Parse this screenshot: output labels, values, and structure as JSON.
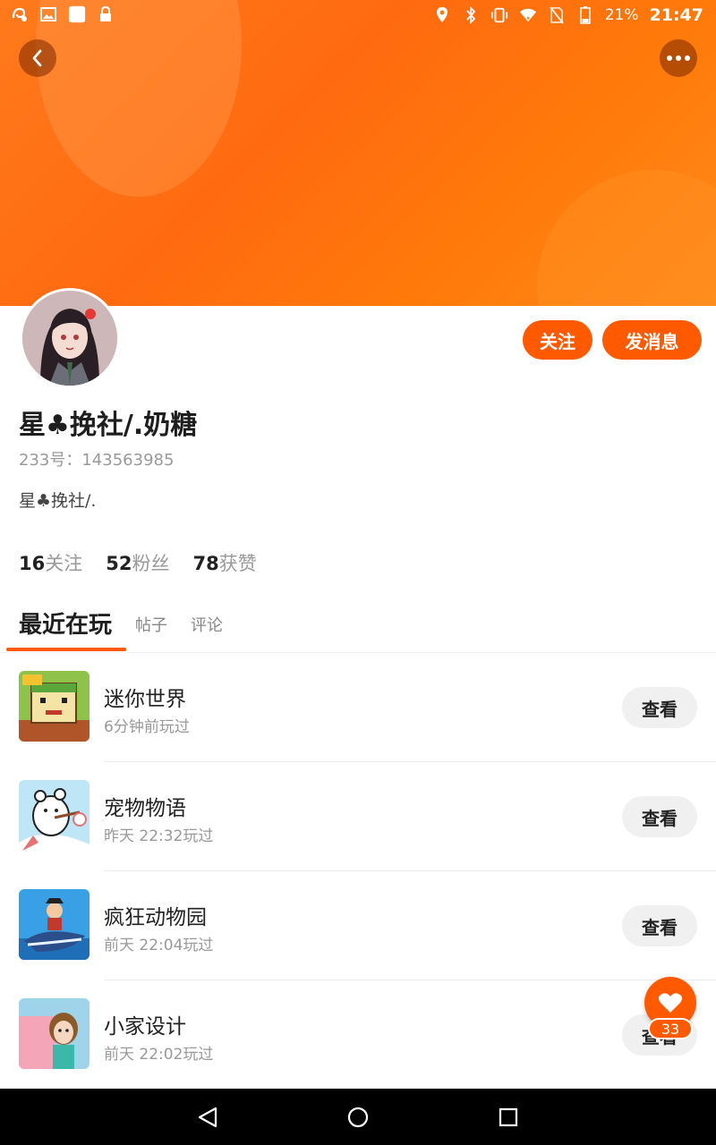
{
  "status_bar": {
    "battery": "21%",
    "time": "21:47",
    "left_icons": [
      "notification-app-icon",
      "image-icon",
      "square-icon",
      "lock-icon"
    ],
    "right_icons": [
      "location-icon",
      "bluetooth-icon",
      "vibrate-icon",
      "wifi-icon",
      "no-sim-icon",
      "battery-icon"
    ]
  },
  "header": {
    "back_icon": "chevron-left-icon",
    "more_icon": "more-dots-icon",
    "banner_color": "#ff6f12"
  },
  "profile": {
    "name": "星♣挽社/.奶糖",
    "id_text": "233号：143563985",
    "bio": "星♣挽社/.",
    "follow_label": "关注",
    "message_label": "发消息",
    "accent_color": "#ff5a00"
  },
  "stats": [
    {
      "num": "16",
      "label": "关注"
    },
    {
      "num": "52",
      "label": "粉丝"
    },
    {
      "num": "78",
      "label": "获赞"
    }
  ],
  "tabs": [
    {
      "label": "最近在玩",
      "active": true
    },
    {
      "label": "帖子",
      "active": false
    },
    {
      "label": "评论",
      "active": false
    }
  ],
  "games": [
    {
      "name": "迷你世界",
      "time": "6分钟前玩过",
      "action": "查看"
    },
    {
      "name": "宠物物语",
      "time": "昨天 22:32玩过",
      "action": "查看"
    },
    {
      "name": "疯狂动物园",
      "time": "前天 22:04玩过",
      "action": "查看"
    },
    {
      "name": "小家设计",
      "time": "前天 22:02玩过",
      "action": "查看"
    }
  ],
  "like_fab": {
    "count": "33",
    "icon": "heart-icon"
  },
  "nav_bar": {
    "icons": [
      "back-triangle-icon",
      "home-circle-icon",
      "recents-square-icon"
    ]
  }
}
